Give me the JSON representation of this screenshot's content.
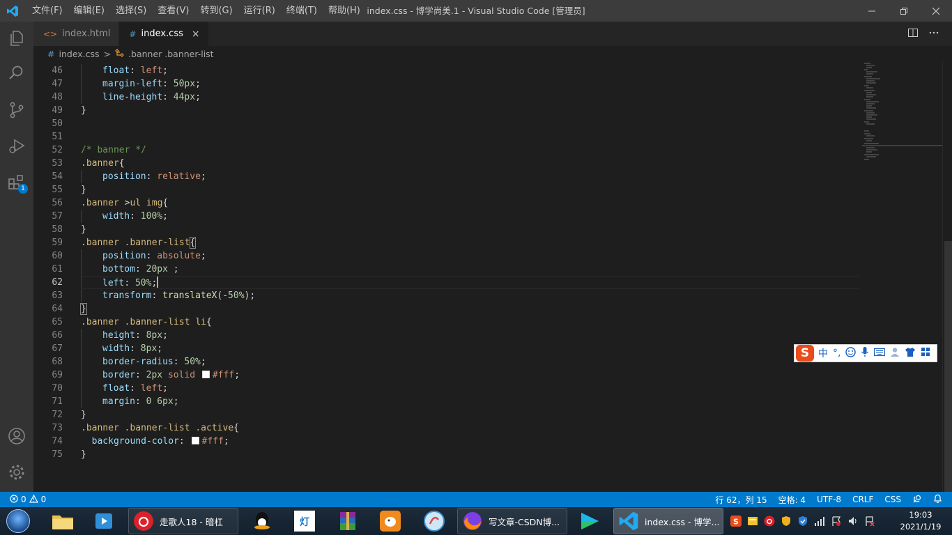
{
  "window": {
    "title": "index.css - 博学尚美.1 - Visual Studio Code [管理员]",
    "menu": [
      "文件(F)",
      "编辑(E)",
      "选择(S)",
      "查看(V)",
      "转到(G)",
      "运行(R)",
      "终端(T)",
      "帮助(H)"
    ]
  },
  "activity_bar": {
    "extensions_badge": "1"
  },
  "tabs": [
    {
      "label": "index.html",
      "icon": "<>"
    },
    {
      "label": "index.css",
      "icon": "#",
      "close": "×"
    }
  ],
  "breadcrumb": {
    "file": "index.css",
    "file_icon": "#",
    "separator": ">",
    "symbol": ".banner .banner-list"
  },
  "editor": {
    "lines": [
      {
        "n": "46"
      },
      {
        "n": "47"
      },
      {
        "n": "48"
      },
      {
        "n": "49"
      },
      {
        "n": "50"
      },
      {
        "n": "51"
      },
      {
        "n": "52"
      },
      {
        "n": "53"
      },
      {
        "n": "54"
      },
      {
        "n": "55"
      },
      {
        "n": "56"
      },
      {
        "n": "57"
      },
      {
        "n": "58"
      },
      {
        "n": "59"
      },
      {
        "n": "60"
      },
      {
        "n": "61"
      },
      {
        "n": "62"
      },
      {
        "n": "63"
      },
      {
        "n": "64"
      },
      {
        "n": "65"
      },
      {
        "n": "66"
      },
      {
        "n": "67"
      },
      {
        "n": "68"
      },
      {
        "n": "69"
      },
      {
        "n": "70"
      },
      {
        "n": "71"
      },
      {
        "n": "72"
      },
      {
        "n": "73"
      },
      {
        "n": "74"
      },
      {
        "n": "75"
      }
    ],
    "current_line": "62"
  },
  "ime": {
    "logo": "S",
    "mode": "中",
    "punct": "°,"
  },
  "status_bar": {
    "errors": "0",
    "warnings": "0",
    "position": "行 62，列 15",
    "spaces": "空格: 4",
    "encoding": "UTF-8",
    "eol": "CRLF",
    "language": "CSS"
  },
  "taskbar": {
    "items": [
      {
        "label": "走歌人18 - 暗杠"
      },
      {
        "label": "写文章-CSDN博..."
      },
      {
        "label": "index.css - 博学..."
      }
    ],
    "clock_time": "19:03",
    "clock_date": "2021/1/19"
  },
  "colors": {
    "accent": "#007acc",
    "editor_bg": "#1e1e1e",
    "selector": "#d7ba7d",
    "property": "#9cdcfe",
    "value": "#ce9178",
    "number": "#b5cea8",
    "comment": "#6a9955"
  }
}
